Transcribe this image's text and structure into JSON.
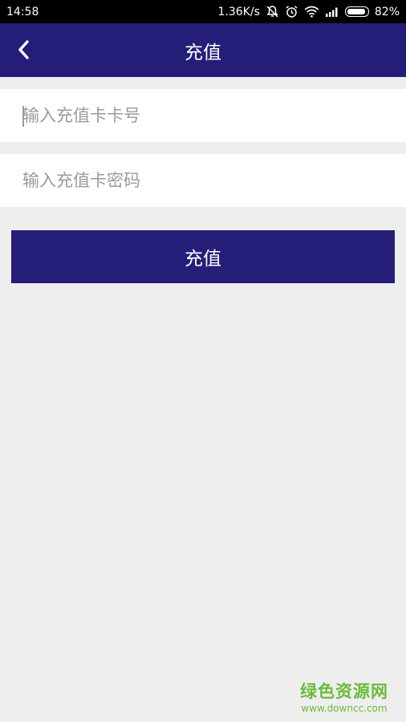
{
  "status_bar": {
    "time": "14:58",
    "network_speed": "1.36K/s",
    "battery_percent": "82%",
    "battery_level": 0.82,
    "icons": [
      "mute-icon",
      "alarm-icon",
      "wifi-icon",
      "signal-icon",
      "battery-icon"
    ]
  },
  "app_bar": {
    "back_icon": "chevron-left-icon",
    "title": "充值"
  },
  "form": {
    "card_number_placeholder": "输入充值卡卡号",
    "card_password_placeholder": "输入充值卡密码",
    "submit_label": "充值"
  },
  "watermark": {
    "name": "绿色资源网",
    "url": "www.downcc.com"
  },
  "colors": {
    "primary": "#241e78",
    "background": "#eeeeee",
    "watermark": "#6cbb3c"
  }
}
